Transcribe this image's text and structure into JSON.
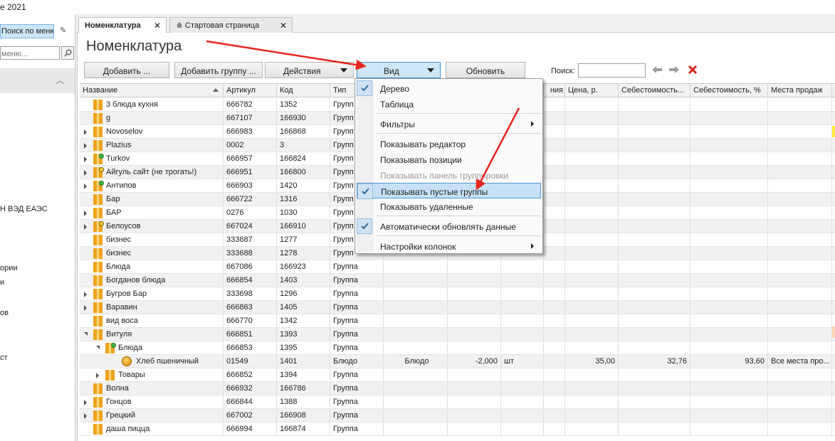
{
  "window": {
    "title_fragment": "е 2021"
  },
  "sidebar": {
    "menu_search_label": "Поиск по меню",
    "search_placeholder": "меню...",
    "items": [
      "Н ВЭД ЕАЭС",
      "ории",
      "и",
      "ов",
      "ст"
    ]
  },
  "tabs": [
    {
      "label": "Номенклатура",
      "active": true
    },
    {
      "label": "Стартовая страница",
      "active": false
    }
  ],
  "page": {
    "title": "Номенклатура"
  },
  "toolbar": {
    "add": "Добавить ...",
    "add_group": "Добавить группу ...",
    "actions": "Действия",
    "view": "Вид",
    "refresh": "Обновить",
    "search_label": "Поиск:",
    "search_value": ""
  },
  "grid": {
    "columns": [
      "Название",
      "Артикул",
      "Код",
      "Тип",
      "",
      "",
      "",
      "ния",
      "Цена, р.",
      "Себестоимость...",
      "Себестоимость, %",
      "Места продаж"
    ],
    "rows": [
      {
        "name": "3 блюда кухня",
        "article": "666782",
        "code": "1352",
        "type": "Групп"
      },
      {
        "name": "g",
        "article": "667107",
        "code": "166930",
        "type": "Групп"
      },
      {
        "name": "Novoselov",
        "article": "666983",
        "code": "166868",
        "type": "Групп"
      },
      {
        "name": "Plazius",
        "article": "0002",
        "code": "3",
        "type": "Групп"
      },
      {
        "name": "Turkov",
        "article": "666957",
        "code": "166824",
        "type": "Групп"
      },
      {
        "name": "Айгуль сайт (не трогать!)",
        "article": "666951",
        "code": "166800",
        "type": "Групп"
      },
      {
        "name": "Антипов",
        "article": "666903",
        "code": "1420",
        "type": "Групп"
      },
      {
        "name": "Бар",
        "article": "666722",
        "code": "1316",
        "type": "Групп"
      },
      {
        "name": "БАР",
        "article": "0276",
        "code": "1030",
        "type": "Групп"
      },
      {
        "name": "Белоусов",
        "article": "667024",
        "code": "166910",
        "type": "Групп"
      },
      {
        "name": "бизнес",
        "article": "333687",
        "code": "1277",
        "type": "Групп"
      },
      {
        "name": "бизнес",
        "article": "333688",
        "code": "1278",
        "type": "Групп"
      },
      {
        "name": "Блюда",
        "article": "667086",
        "code": "166923",
        "type": "Группа"
      },
      {
        "name": "Богданов блюда",
        "article": "666854",
        "code": "1403",
        "type": "Группа"
      },
      {
        "name": "Бугров Бар",
        "article": "333698",
        "code": "1296",
        "type": "Группа"
      },
      {
        "name": "Варавин",
        "article": "666863",
        "code": "1405",
        "type": "Группа"
      },
      {
        "name": "вид воса",
        "article": "666770",
        "code": "1342",
        "type": "Группа"
      },
      {
        "name": "Витуля",
        "article": "666851",
        "code": "1393",
        "type": "Группа"
      },
      {
        "name": "Блюда",
        "article": "666853",
        "code": "1395",
        "type": "Группа"
      },
      {
        "name": "Хлеб пшеничный",
        "article": "01549",
        "code": "1401",
        "type": "Блюдо",
        "subtype": "Блюдо",
        "amount": "-2,000",
        "unit": "шт",
        "price": "35,00",
        "cost": "32,76",
        "cost_pct": "93,60",
        "places": "Все места про..."
      },
      {
        "name": "Товары",
        "article": "666852",
        "code": "1394",
        "type": "Группа"
      },
      {
        "name": "Волна",
        "article": "666932",
        "code": "166786",
        "type": "Группа"
      },
      {
        "name": "Гонцов",
        "article": "666844",
        "code": "1388",
        "type": "Группа"
      },
      {
        "name": "Грецкий",
        "article": "667002",
        "code": "166908",
        "type": "Группа"
      },
      {
        "name": "даша пицца",
        "article": "666994",
        "code": "166874",
        "type": "Группа"
      }
    ]
  },
  "view_menu": {
    "items": [
      {
        "label": "Дерево",
        "checked": true
      },
      {
        "label": "Таблица",
        "checked": false
      },
      {
        "label": "Фильтры",
        "checked": false,
        "submenu": true
      },
      {
        "label": "Показывать редактор",
        "checked": false
      },
      {
        "label": "Показывать позиции",
        "checked": false
      },
      {
        "label": "Показывать панель группировки",
        "checked": false,
        "disabled": true
      },
      {
        "label": "Показывать пустые группы",
        "checked": true,
        "highlighted": true
      },
      {
        "label": "Показывать удаленные",
        "checked": false
      },
      {
        "label": "Автоматически обновлять данные",
        "checked": true
      },
      {
        "label": "Настройки колонок",
        "checked": false,
        "submenu": true
      }
    ]
  },
  "colors": {
    "accent": "#3c8fd8",
    "annotation": "#e8261c",
    "folder": "#f0a21c"
  }
}
